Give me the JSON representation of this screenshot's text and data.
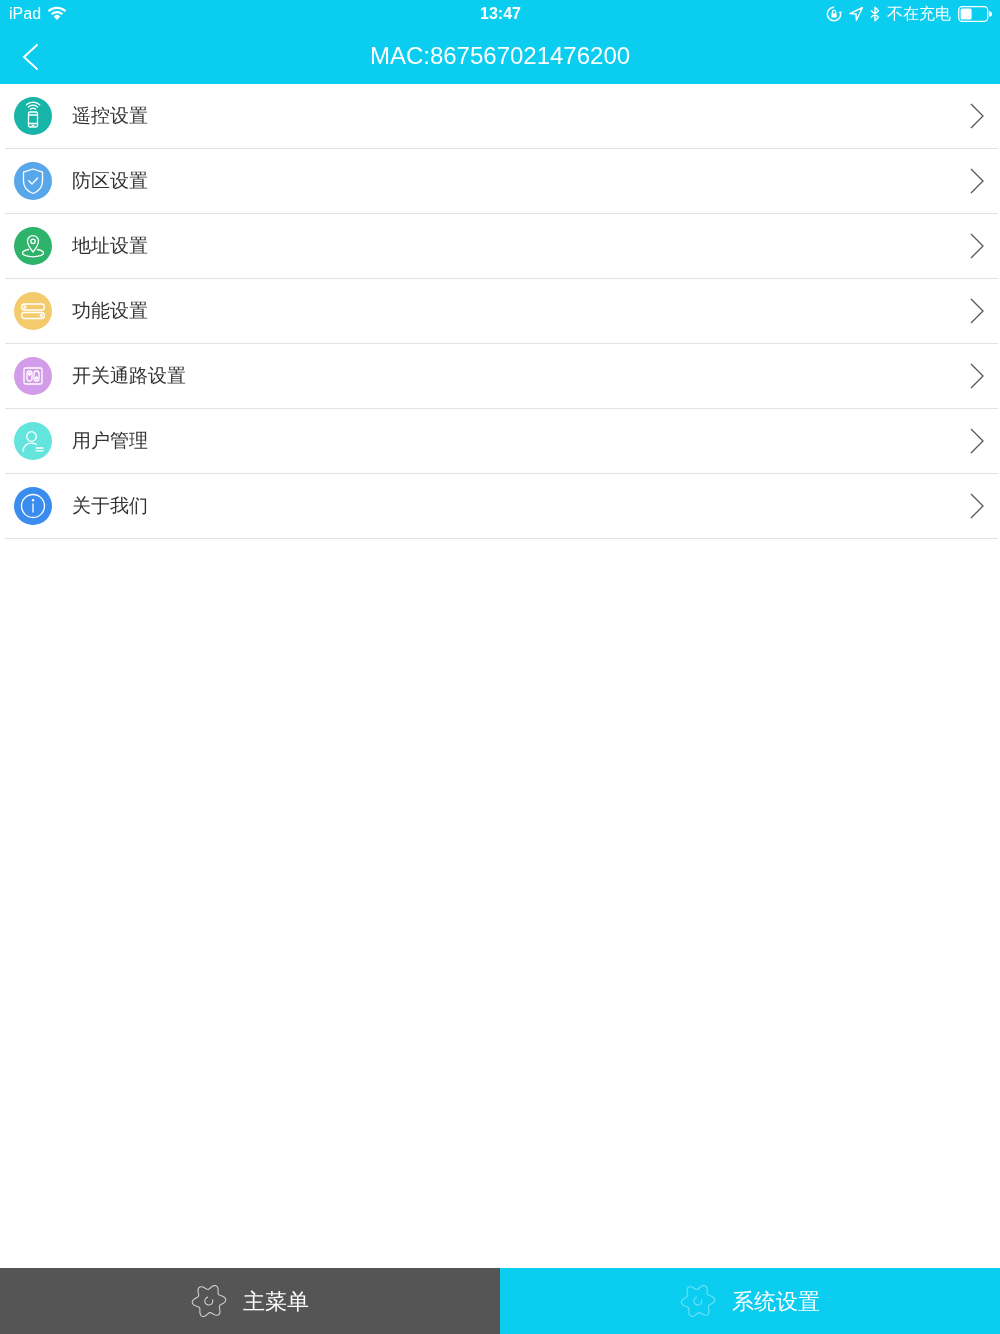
{
  "status_bar": {
    "device": "iPad",
    "time": "13:47",
    "charging_status": "不在充电"
  },
  "nav_bar": {
    "title": "MAC:867567021476200"
  },
  "menu_items": [
    {
      "label": "遥控设置",
      "kind": "remote",
      "color": "#17b4a8"
    },
    {
      "label": "防区设置",
      "kind": "shield",
      "color": "#58a7ea"
    },
    {
      "label": "地址设置",
      "kind": "location",
      "color": "#2eb36b"
    },
    {
      "label": "功能设置",
      "kind": "function",
      "color": "#f3cb6c"
    },
    {
      "label": "开关通路设置",
      "kind": "switch",
      "color": "#d39ce9"
    },
    {
      "label": "用户管理",
      "kind": "user",
      "color": "#63e4dc"
    },
    {
      "label": "关于我们",
      "kind": "info",
      "color": "#3b8cef"
    }
  ],
  "tab_bar": {
    "tabs": [
      {
        "label": "主菜单",
        "selected": false
      },
      {
        "label": "系统设置",
        "selected": true
      }
    ]
  }
}
